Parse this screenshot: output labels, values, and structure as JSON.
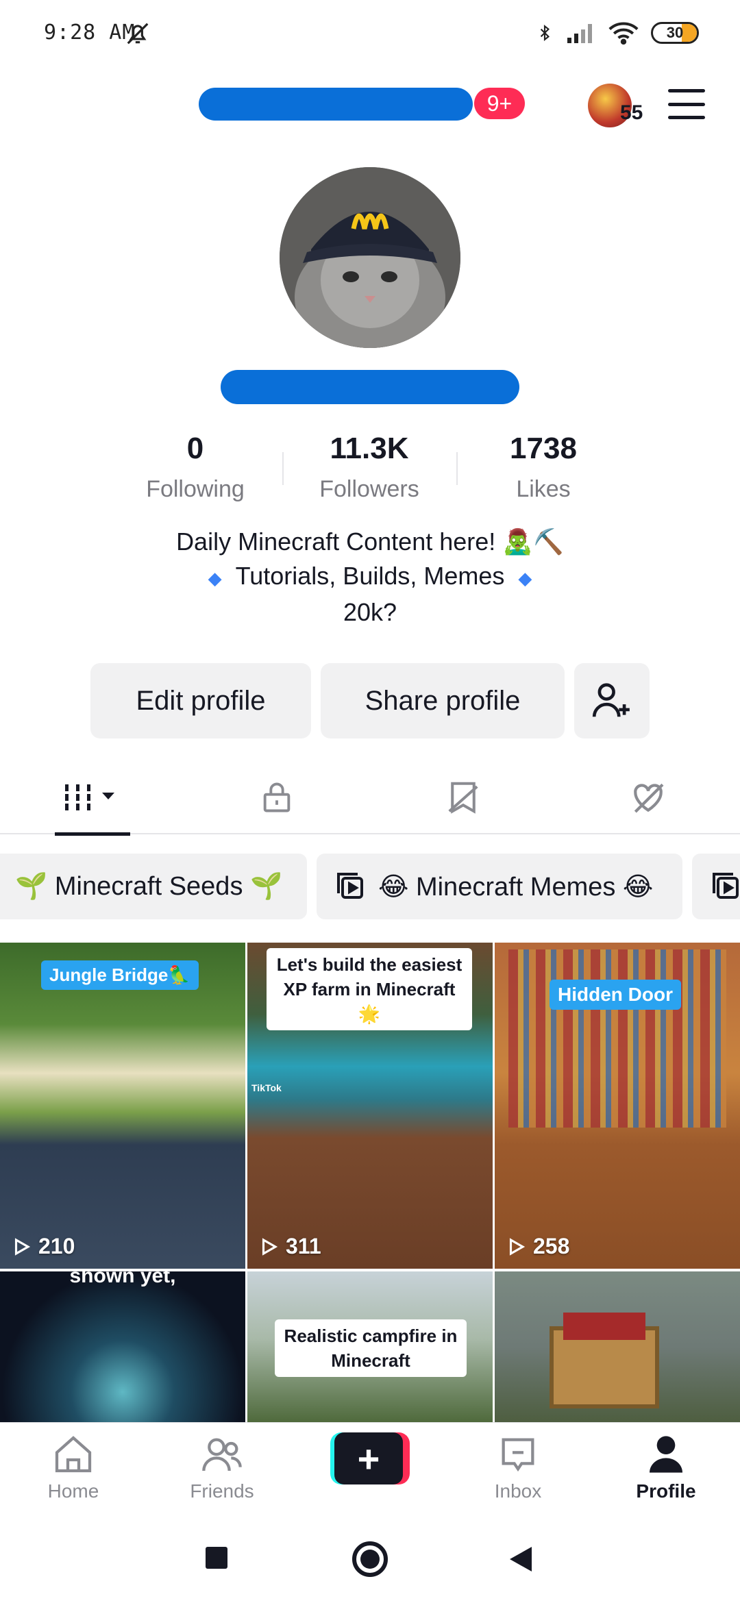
{
  "status_bar": {
    "time": "9:28 AM",
    "battery": "30"
  },
  "header": {
    "notification_badge": "9+",
    "coin_count": "55"
  },
  "stats": [
    {
      "value": "0",
      "label": "Following"
    },
    {
      "value": "11.3K",
      "label": "Followers"
    },
    {
      "value": "1738",
      "label": "Likes"
    }
  ],
  "bio": {
    "line1": "Daily Minecraft Content here! 🧟‍♂️⛏️",
    "line2": "Tutorials, Builds, Memes",
    "line3": "20k?",
    "diamond": "◆"
  },
  "buttons": {
    "edit_profile": "Edit profile",
    "share_profile": "Share profile"
  },
  "playlists": [
    {
      "label": "🌱 Minecraft Seeds 🌱"
    },
    {
      "label": "😂 Minecraft Memes 😂"
    }
  ],
  "videos": [
    {
      "caption": "Jungle Bridge🦜",
      "views": "210"
    },
    {
      "caption": "Let's build the easiest XP farm in Minecraft 🌟",
      "views": "311",
      "watermark": "TikTok"
    },
    {
      "caption": "Hidden Door",
      "views": "258"
    },
    {
      "caption": "shown yet,"
    },
    {
      "caption": "Realistic campfire in Minecraft"
    },
    {
      "caption": ""
    }
  ],
  "bottom_nav": {
    "home": "Home",
    "friends": "Friends",
    "create": "+",
    "inbox": "Inbox",
    "profile": "Profile"
  },
  "colors": {
    "accent": "#fe2c55",
    "create_cyan": "#25f4ee",
    "text": "#161823",
    "secondary": "#8a8b91"
  },
  "icons": [
    "bell-off-icon",
    "bluetooth-icon",
    "signal-icon",
    "wifi-icon",
    "battery-icon",
    "menu-icon",
    "add-friend-icon",
    "grid-icon",
    "lock-icon",
    "repost-icon",
    "liked-icon",
    "playlist-icon",
    "play-icon",
    "home-icon",
    "friends-icon",
    "inbox-icon",
    "profile-icon"
  ]
}
